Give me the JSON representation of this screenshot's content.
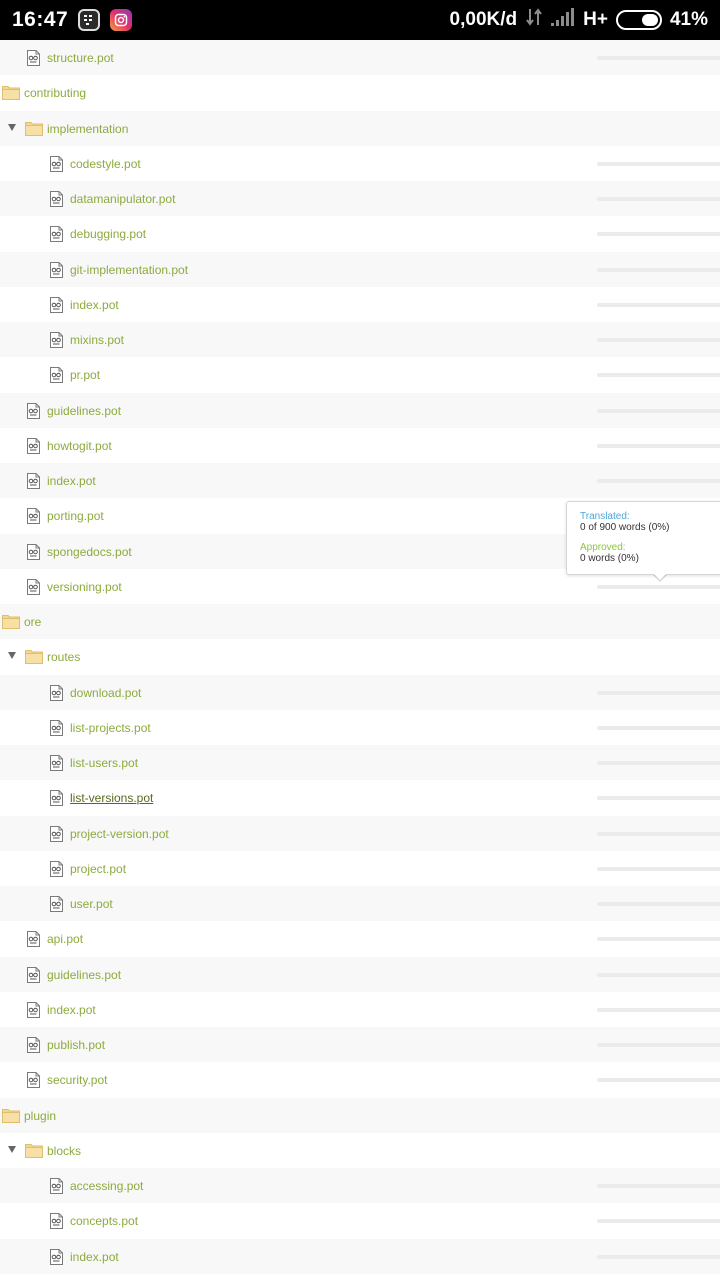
{
  "status_bar": {
    "time": "16:47",
    "network_speed": "0,00K/d",
    "network_type": "H+",
    "battery_percent": "41%",
    "battery_level": 0.41,
    "notification_icons": [
      "bbm-icon",
      "instagram-icon"
    ]
  },
  "tree": {
    "rows": [
      {
        "type": "file",
        "label": "structure.pot",
        "level": 1
      },
      {
        "type": "folder",
        "label": "contributing",
        "level": 0,
        "expanded": false
      },
      {
        "type": "folder",
        "label": "implementation",
        "level": 1,
        "expanded": true
      },
      {
        "type": "file",
        "label": "codestyle.pot",
        "level": 2
      },
      {
        "type": "file",
        "label": "datamanipulator.pot",
        "level": 2
      },
      {
        "type": "file",
        "label": "debugging.pot",
        "level": 2
      },
      {
        "type": "file",
        "label": "git-implementation.pot",
        "level": 2
      },
      {
        "type": "file",
        "label": "index.pot",
        "level": 2
      },
      {
        "type": "file",
        "label": "mixins.pot",
        "level": 2
      },
      {
        "type": "file",
        "label": "pr.pot",
        "level": 2
      },
      {
        "type": "file",
        "label": "guidelines.pot",
        "level": 1
      },
      {
        "type": "file",
        "label": "howtogit.pot",
        "level": 1
      },
      {
        "type": "file",
        "label": "index.pot",
        "level": 1
      },
      {
        "type": "file",
        "label": "porting.pot",
        "level": 1
      },
      {
        "type": "file",
        "label": "spongedocs.pot",
        "level": 1
      },
      {
        "type": "file",
        "label": "versioning.pot",
        "level": 1
      },
      {
        "type": "folder",
        "label": "ore",
        "level": 0,
        "expanded": false
      },
      {
        "type": "folder",
        "label": "routes",
        "level": 1,
        "expanded": true
      },
      {
        "type": "file",
        "label": "download.pot",
        "level": 2
      },
      {
        "type": "file",
        "label": "list-projects.pot",
        "level": 2
      },
      {
        "type": "file",
        "label": "list-users.pot",
        "level": 2
      },
      {
        "type": "file",
        "label": "list-versions.pot",
        "level": 2,
        "hovered": true
      },
      {
        "type": "file",
        "label": "project-version.pot",
        "level": 2
      },
      {
        "type": "file",
        "label": "project.pot",
        "level": 2
      },
      {
        "type": "file",
        "label": "user.pot",
        "level": 2
      },
      {
        "type": "file",
        "label": "api.pot",
        "level": 1
      },
      {
        "type": "file",
        "label": "guidelines.pot",
        "level": 1
      },
      {
        "type": "file",
        "label": "index.pot",
        "level": 1
      },
      {
        "type": "file",
        "label": "publish.pot",
        "level": 1
      },
      {
        "type": "file",
        "label": "security.pot",
        "level": 1
      },
      {
        "type": "folder",
        "label": "plugin",
        "level": 0,
        "expanded": false
      },
      {
        "type": "folder",
        "label": "blocks",
        "level": 1,
        "expanded": true
      },
      {
        "type": "file",
        "label": "accessing.pot",
        "level": 2
      },
      {
        "type": "file",
        "label": "concepts.pot",
        "level": 2
      },
      {
        "type": "file",
        "label": "index.pot",
        "level": 2
      }
    ]
  },
  "tooltip": {
    "translated_label": "Translated:",
    "translated_value": "0 of 900 words (0%)",
    "approved_label": "Approved:",
    "approved_value": "0 words (0%)"
  },
  "colors": {
    "link_green": "#8cab3e",
    "folder_yellow": "#f2d896",
    "translated_blue": "#4ea6dc",
    "approved_green": "#8cc63f"
  }
}
